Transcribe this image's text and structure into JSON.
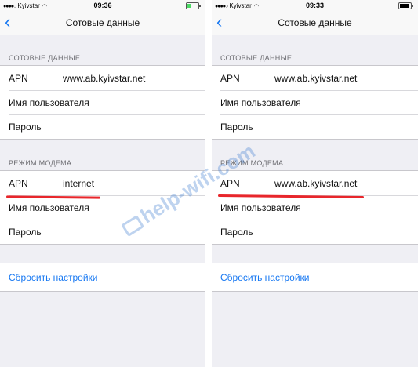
{
  "panels": [
    {
      "status": {
        "carrier": "Kyivstar",
        "time": "09:36",
        "battery_level": 0.3,
        "battery_color": "#4cd964"
      },
      "nav": {
        "title": "Сотовые данные",
        "back_icon": "chevron-left-icon"
      },
      "cellular": {
        "header": "СОТОВЫЕ ДАННЫЕ",
        "rows": [
          {
            "label": "APN",
            "value": "www.ab.kyivstar.net"
          },
          {
            "label": "Имя пользователя",
            "value": ""
          },
          {
            "label": "Пароль",
            "value": ""
          }
        ]
      },
      "hotspot": {
        "header": "РЕЖИМ МОДЕМА",
        "rows": [
          {
            "label": "APN",
            "value": "internet"
          },
          {
            "label": "Имя пользователя",
            "value": ""
          },
          {
            "label": "Пароль",
            "value": ""
          }
        ]
      },
      "reset_label": "Сбросить настройки"
    },
    {
      "status": {
        "carrier": "Kyivstar",
        "time": "09:33",
        "battery_level": 0.9,
        "battery_color": "#000000"
      },
      "nav": {
        "title": "Сотовые данные",
        "back_icon": "chevron-left-icon"
      },
      "cellular": {
        "header": "СОТОВЫЕ ДАННЫЕ",
        "rows": [
          {
            "label": "APN",
            "value": "www.ab.kyivstar.net"
          },
          {
            "label": "Имя пользователя",
            "value": ""
          },
          {
            "label": "Пароль",
            "value": ""
          }
        ]
      },
      "hotspot": {
        "header": "РЕЖИМ МОДЕМА",
        "rows": [
          {
            "label": "APN",
            "value": "www.ab.kyivstar.net"
          },
          {
            "label": "Имя пользователя",
            "value": ""
          },
          {
            "label": "Пароль",
            "value": ""
          }
        ]
      },
      "reset_label": "Сбросить настройки"
    }
  ],
  "watermark": {
    "text": "help-wifi.com"
  },
  "colors": {
    "accent": "#1778f2",
    "highlight": "#e8262b",
    "background": "#efeff4"
  }
}
